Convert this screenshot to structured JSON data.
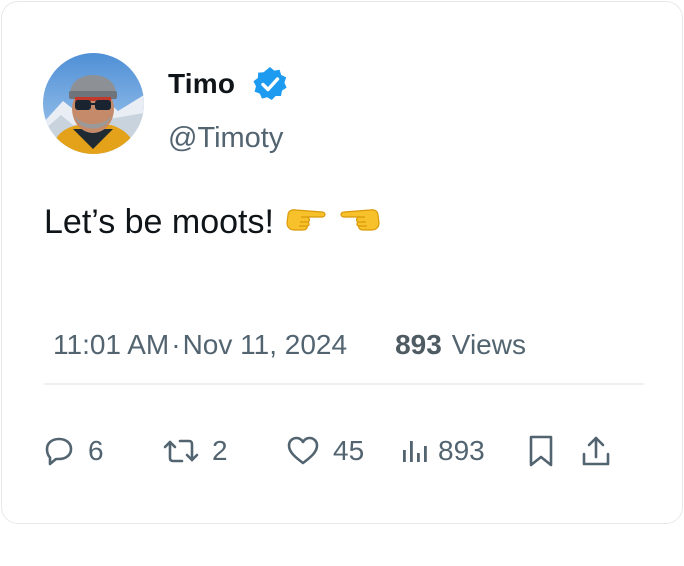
{
  "user": {
    "display_name": "Timo",
    "handle": "@Timoty",
    "verified_icon": "verified-badge-icon",
    "avatar_icon": "avatar-photo"
  },
  "tweet": {
    "text": "Let’s be moots!",
    "emojis": [
      "backhand-index-pointing-right",
      "backhand-index-pointing-left"
    ],
    "time": "11:01 AM",
    "separator": "·",
    "date": "Nov 11, 2024",
    "views_count": "893",
    "views_label": "Views"
  },
  "actions": {
    "replies": "6",
    "retweets": "2",
    "likes": "45",
    "views": "893"
  },
  "colors": {
    "verified_blue": "#1d9bf0",
    "text_primary": "#0f1419",
    "text_secondary": "#536471",
    "divider": "#eef0f2"
  }
}
